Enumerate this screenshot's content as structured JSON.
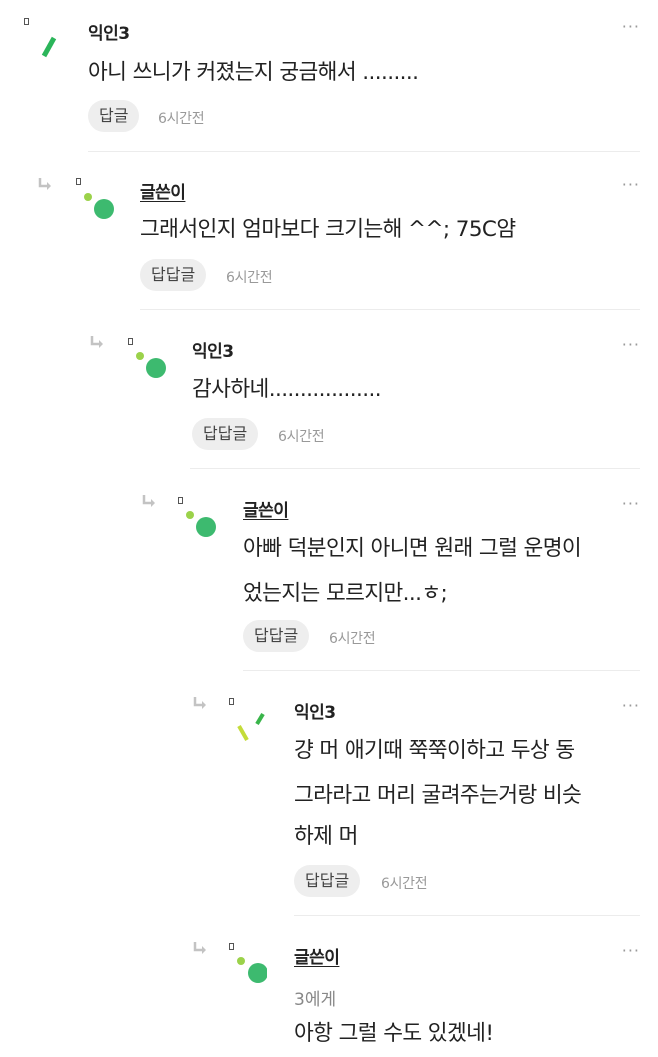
{
  "comments": [
    {
      "author": "익인3",
      "lines": [
        "아니 쓰니가 커졌는지 궁금해서 ........."
      ],
      "reply_label": "답글",
      "time": "6시간전",
      "more": "···"
    },
    {
      "author": "글쓴이",
      "lines": [
        "그래서인지 엄마보다 크기는해 ^^; 75C얌"
      ],
      "reply_label": "답답글",
      "time": "6시간전",
      "more": "···"
    },
    {
      "author": "익인3",
      "lines": [
        "감사하네.................."
      ],
      "reply_label": "답답글",
      "time": "6시간전",
      "more": "···"
    },
    {
      "author": "글쓴이",
      "lines": [
        "아빠 덕분인지 아니면 원래 그럴 운명이",
        "었는지는 모르지만...ㅎ;"
      ],
      "reply_label": "답답글",
      "time": "6시간전",
      "more": "···"
    },
    {
      "author": "익인3",
      "lines": [
        "걍 머 애기때 쭉쭉이하고 두상 동",
        "그라라고 머리 굴려주는거랑 비슷",
        "하제 머"
      ],
      "reply_label": "답답글",
      "time": "6시간전",
      "more": "···"
    },
    {
      "author": "글쓴이",
      "mention": "3에게",
      "lines": [
        "아항 그럴 수도 있겠네!"
      ],
      "more": "···"
    }
  ]
}
